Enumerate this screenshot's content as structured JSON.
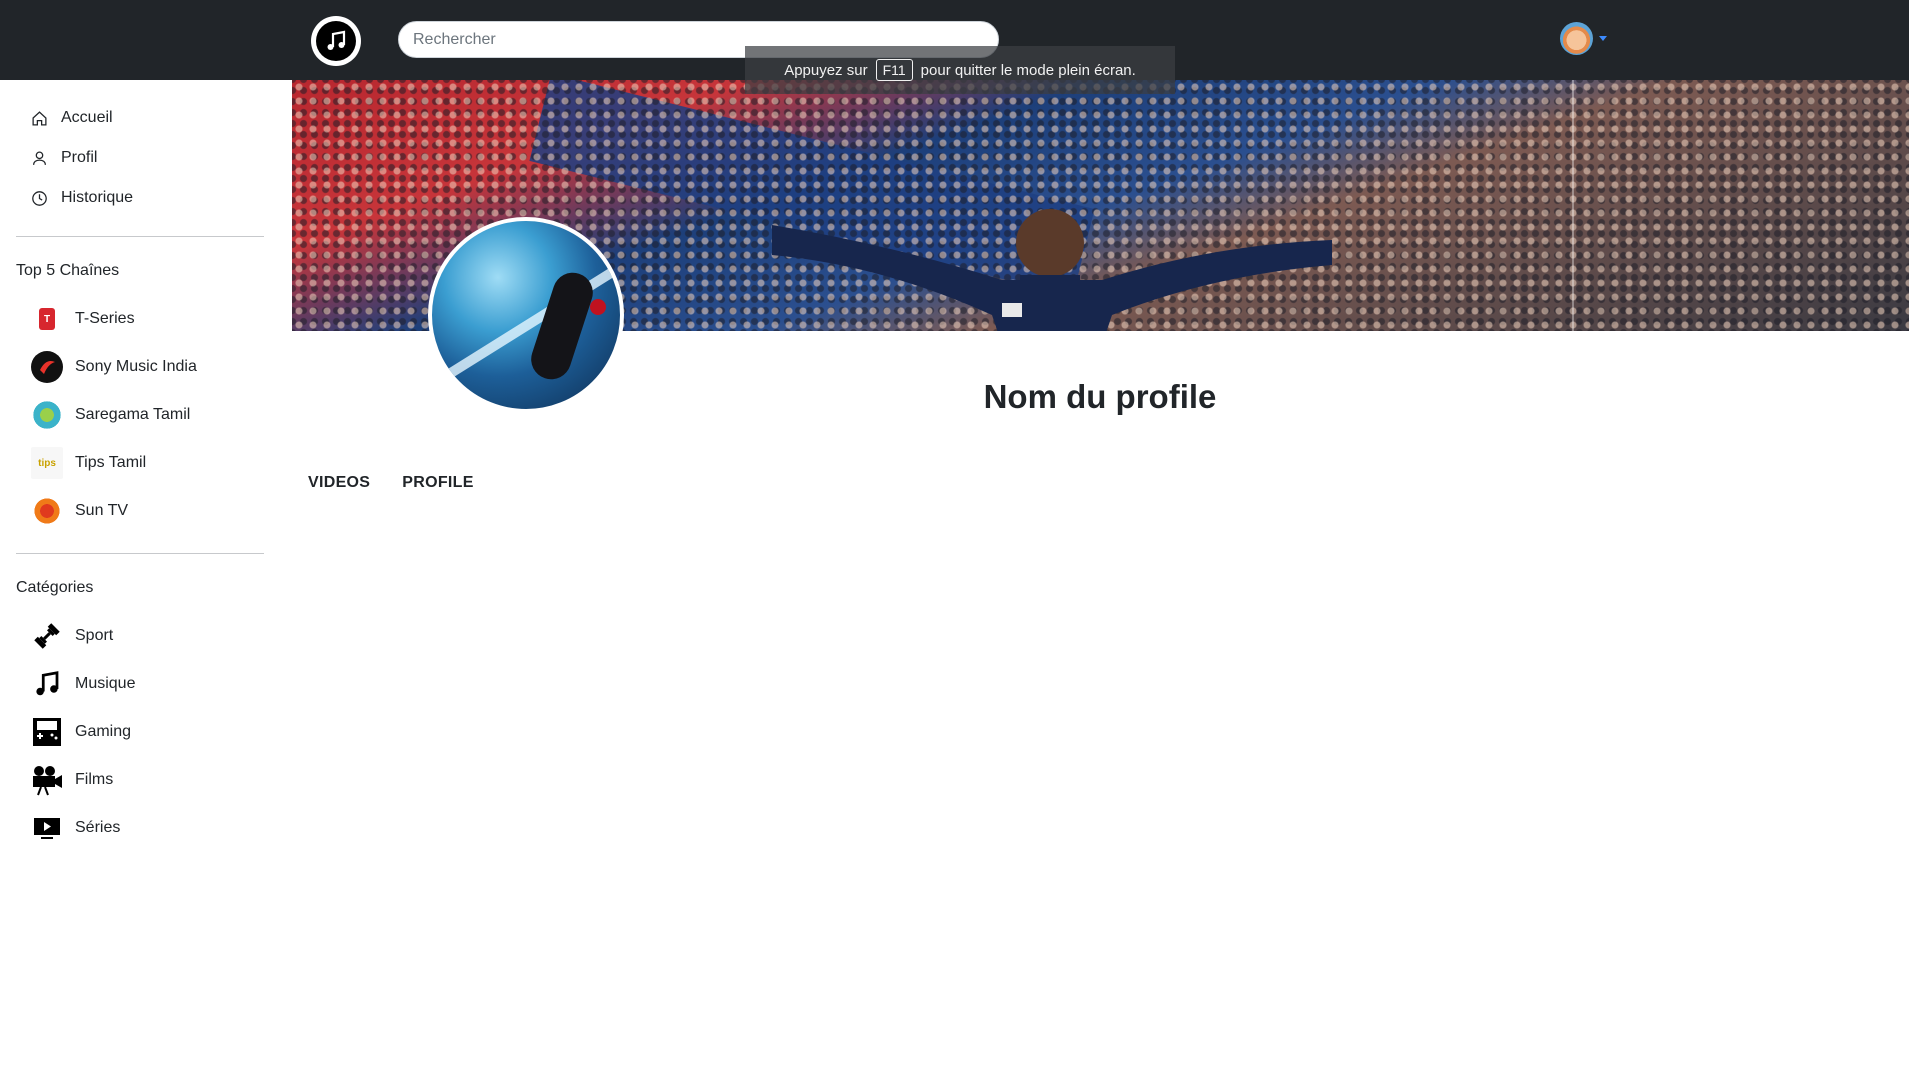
{
  "header": {
    "logo_icon": "music-note-icon",
    "search_placeholder": "Rechercher",
    "fullscreen_toast": {
      "before": "Appuyez sur",
      "key": "F11",
      "after": "pour quitter le mode plein écran."
    },
    "accent_color": "#3d8bfd",
    "background": "#212529"
  },
  "sidebar": {
    "nav": [
      {
        "label": "Accueil",
        "icon": "home-icon"
      },
      {
        "label": "Profil",
        "icon": "user-icon"
      },
      {
        "label": "Historique",
        "icon": "clock-icon"
      }
    ],
    "top_channels_title": "Top 5 Chaînes",
    "top_channels": [
      {
        "label": "T-Series",
        "icon": "t-series-logo-icon",
        "color": "#d7262e"
      },
      {
        "label": "Sony Music India",
        "icon": "sony-music-logo-icon",
        "color": "#e8322a"
      },
      {
        "label": "Saregama Tamil",
        "icon": "saregama-logo-icon",
        "color": "#3bb3c9"
      },
      {
        "label": "Tips Tamil",
        "icon": "tips-tamil-logo-icon",
        "color": "#f2c230"
      },
      {
        "label": "Sun TV",
        "icon": "sun-tv-logo-icon",
        "color": "#f07a18"
      }
    ],
    "categories_title": "Catégories",
    "categories": [
      {
        "label": "Sport",
        "icon": "dumbbell-icon"
      },
      {
        "label": "Musique",
        "icon": "music-note-icon"
      },
      {
        "label": "Gaming",
        "icon": "gaming-console-icon"
      },
      {
        "label": "Films",
        "icon": "film-camera-icon"
      },
      {
        "label": "Séries",
        "icon": "tv-play-icon"
      }
    ]
  },
  "profile": {
    "name": "Nom du profile",
    "tabs": [
      "VIDEOS",
      "PROFILE"
    ]
  }
}
